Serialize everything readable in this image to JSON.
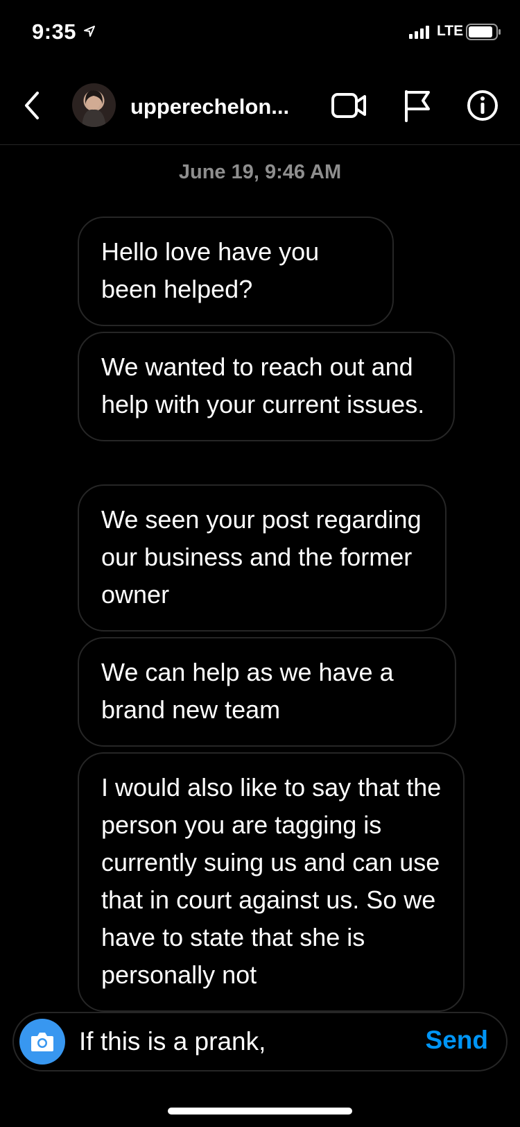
{
  "status_bar": {
    "time": "9:35",
    "network": "LTE"
  },
  "header": {
    "username": "upperechelon...",
    "icons": [
      "back-icon",
      "video-call-icon",
      "flag-icon",
      "info-icon"
    ]
  },
  "thread": {
    "timestamp": "June 19, 9:46 AM",
    "messages": [
      "Hello love have you been helped?",
      "We wanted to reach out and help with your current issues.",
      "We seen your post regarding our business and the former owner",
      "We can help as we have a brand new team",
      "I would also like to say that the person you are tagging is currently suing us and can use that in court against us. So we have to state that she is personally not"
    ]
  },
  "composer": {
    "value": "If this is a prank,",
    "send_label": "Send",
    "camera_icon": "camera-icon"
  },
  "colors": {
    "background": "#000000",
    "bubble_border": "#262626",
    "accent": "#0095f6",
    "camera_bg": "#3897f0",
    "timestamp": "#8e8e8e"
  }
}
